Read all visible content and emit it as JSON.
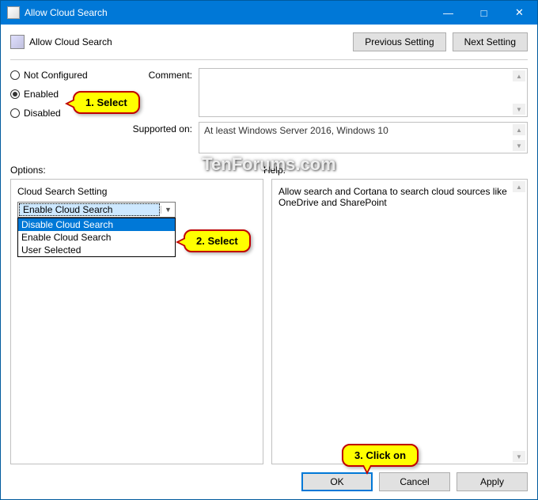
{
  "titlebar": {
    "title": "Allow Cloud Search"
  },
  "header": {
    "title": "Allow Cloud Search"
  },
  "nav": {
    "prev": "Previous Setting",
    "next": "Next Setting"
  },
  "radios": {
    "not_configured": "Not Configured",
    "enabled": "Enabled",
    "disabled": "Disabled",
    "selected": "enabled"
  },
  "labels": {
    "comment": "Comment:",
    "supported": "Supported on:",
    "options": "Options:",
    "help": "Help:"
  },
  "supported_text": "At least Windows Server 2016, Windows 10",
  "options_panel": {
    "setting_label": "Cloud Search Setting",
    "selected": "Enable Cloud Search",
    "items": [
      "Disable Cloud Search",
      "Enable Cloud Search",
      "User Selected"
    ],
    "highlighted_index": 0
  },
  "help_text": "Allow search and Cortana to search cloud sources like OneDrive and SharePoint",
  "buttons": {
    "ok": "OK",
    "cancel": "Cancel",
    "apply": "Apply"
  },
  "callouts": {
    "c1": "1. Select",
    "c2": "2. Select",
    "c3": "3. Click on"
  },
  "watermark": "TenForums.com"
}
